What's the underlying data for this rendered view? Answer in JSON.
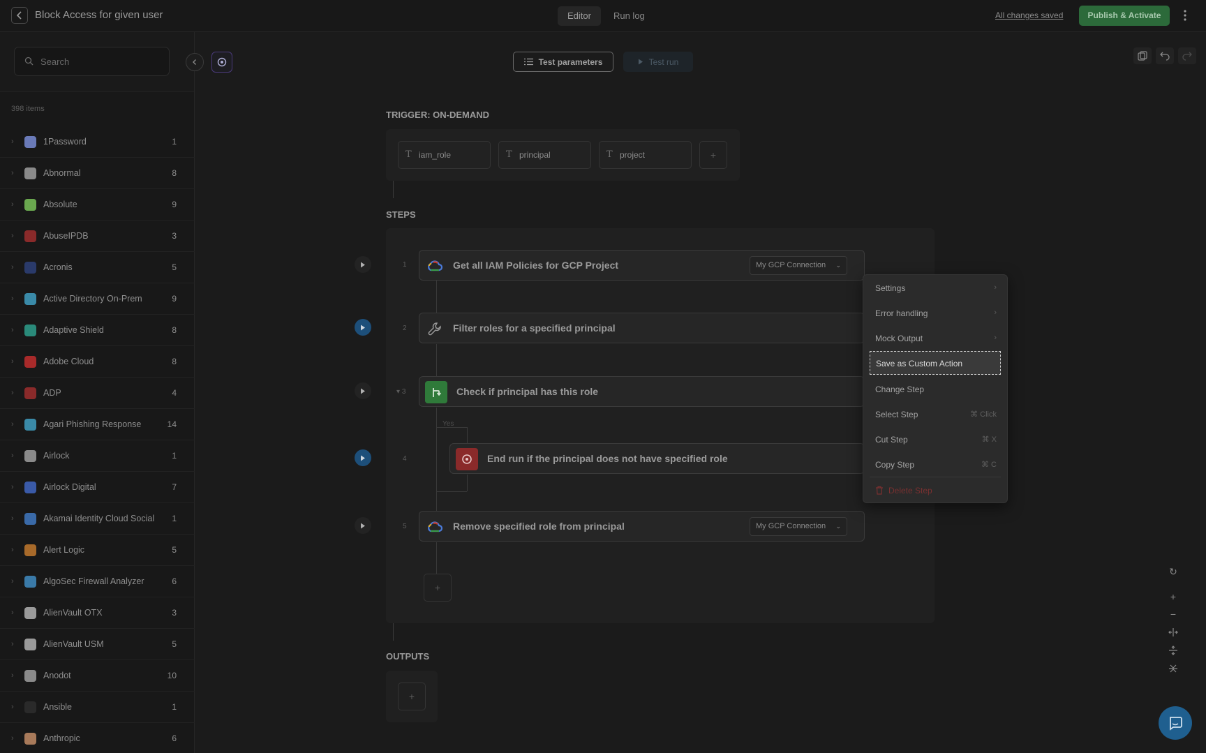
{
  "header": {
    "title": "Block Access for given user",
    "tabs": [
      "Editor",
      "Run log"
    ],
    "active_tab": "Editor",
    "saved_status": "All changes saved",
    "publish_label": "Publish & Activate"
  },
  "sidebar": {
    "search_placeholder": "Search",
    "count_label": "398 items",
    "items": [
      {
        "name": "1Password",
        "count": "1",
        "icon": "1password-icon",
        "color": "#6a7ab8"
      },
      {
        "name": "Abnormal",
        "count": "8",
        "icon": "abnormal-icon",
        "color": "#8a8a8a"
      },
      {
        "name": "Absolute",
        "count": "9",
        "icon": "absolute-icon",
        "color": "#6aa84f"
      },
      {
        "name": "AbuseIPDB",
        "count": "3",
        "icon": "abuseipdb-icon",
        "color": "#8a2a2a"
      },
      {
        "name": "Acronis",
        "count": "5",
        "icon": "acronis-icon",
        "color": "#2a3a6a"
      },
      {
        "name": "Active Directory On-Prem",
        "count": "9",
        "icon": "active-directory-icon",
        "color": "#3a8aa8"
      },
      {
        "name": "Adaptive Shield",
        "count": "8",
        "icon": "adaptive-shield-icon",
        "color": "#2a8a7a"
      },
      {
        "name": "Adobe Cloud",
        "count": "8",
        "icon": "adobe-cloud-icon",
        "color": "#a82a2a"
      },
      {
        "name": "ADP",
        "count": "4",
        "icon": "adp-icon",
        "color": "#8a2a2a"
      },
      {
        "name": "Agari Phishing Response",
        "count": "14",
        "icon": "agari-icon",
        "color": "#3a8aa8"
      },
      {
        "name": "Airlock",
        "count": "1",
        "icon": "airlock-icon",
        "color": "#8a8a8a"
      },
      {
        "name": "Airlock Digital",
        "count": "7",
        "icon": "airlock-digital-icon",
        "color": "#3a5aa8"
      },
      {
        "name": "Akamai Identity Cloud Social",
        "count": "1",
        "icon": "akamai-icon",
        "color": "#3a6aa8"
      },
      {
        "name": "Alert Logic",
        "count": "5",
        "icon": "alert-logic-icon",
        "color": "#a86a2a"
      },
      {
        "name": "AlgoSec Firewall Analyzer",
        "count": "6",
        "icon": "algosec-icon",
        "color": "#3a7aa8"
      },
      {
        "name": "AlienVault OTX",
        "count": "3",
        "icon": "alienvault-otx-icon",
        "color": "#9a9a9a"
      },
      {
        "name": "AlienVault USM",
        "count": "5",
        "icon": "alienvault-usm-icon",
        "color": "#9a9a9a"
      },
      {
        "name": "Anodot",
        "count": "10",
        "icon": "anodot-icon",
        "color": "#8a8a8a"
      },
      {
        "name": "Ansible",
        "count": "1",
        "icon": "ansible-icon",
        "color": "#2a2a2a"
      },
      {
        "name": "Anthropic",
        "count": "6",
        "icon": "anthropic-icon",
        "color": "#a87a5a"
      }
    ]
  },
  "toolbar": {
    "test_parameters_label": "Test parameters",
    "test_run_label": "Test run"
  },
  "trigger": {
    "title": "TRIGGER: ON-DEMAND",
    "type_glyph": "T",
    "params": [
      "iam_role",
      "principal",
      "project"
    ]
  },
  "steps": {
    "title": "STEPS",
    "yes_label": "Yes",
    "items": [
      {
        "num": "1",
        "title": "Get all IAM Policies for GCP Project",
        "connection": "My GCP Connection",
        "icon": "gcp-icon"
      },
      {
        "num": "2",
        "title": "Filter roles for a specified principal",
        "connection": "",
        "icon": "wrench-icon"
      },
      {
        "num": "3",
        "title": "Check if principal has this role",
        "connection": "",
        "icon": "branch-icon"
      },
      {
        "num": "4",
        "title": "End run if the principal does not have specified role",
        "connection": "",
        "icon": "stop-icon"
      },
      {
        "num": "5",
        "title": "Remove specified role from principal",
        "connection": "My GCP Connection",
        "icon": "gcp-icon"
      }
    ]
  },
  "outputs": {
    "title": "OUTPUTS"
  },
  "context_menu": {
    "items": [
      {
        "label": "Settings",
        "right": "›"
      },
      {
        "label": "Error handling",
        "right": "›"
      },
      {
        "label": "Mock Output",
        "right": "›"
      },
      {
        "label": "Save as Custom Action",
        "right": ""
      },
      {
        "label": "Change Step",
        "right": ""
      },
      {
        "label": "Select Step",
        "right": "⌘ Click"
      },
      {
        "label": "Cut Step",
        "right": "⌘ X"
      },
      {
        "label": "Copy Step",
        "right": "⌘ C"
      },
      {
        "label": "Delete Step",
        "right": ""
      }
    ],
    "selected": "Save as Custom Action"
  },
  "colors": {
    "accent_green": "#2c6a3a",
    "accent_blue": "#1d4f7a",
    "danger": "#7a3030"
  }
}
